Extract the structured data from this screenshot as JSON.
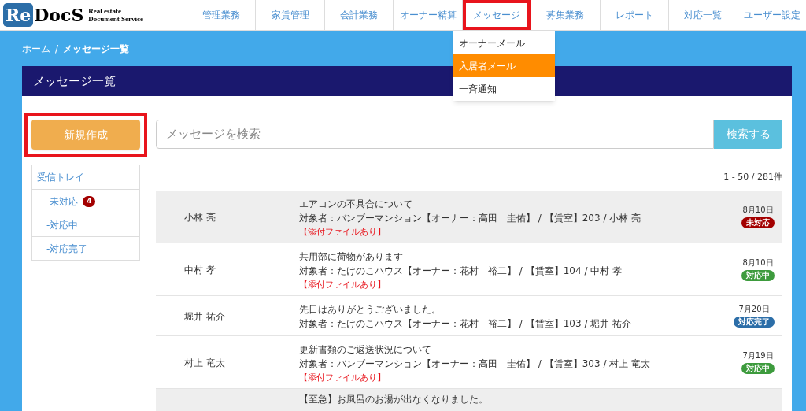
{
  "logo": {
    "mark": "Re",
    "name": "DocS",
    "tagline": [
      "Real estate",
      "Document Service"
    ]
  },
  "nav": [
    {
      "label": "管理業務",
      "annotated": false
    },
    {
      "label": "家賃管理",
      "annotated": false
    },
    {
      "label": "会計業務",
      "annotated": false
    },
    {
      "label": "オーナー精算",
      "annotated": false
    },
    {
      "label": "メッセージ",
      "annotated": true
    },
    {
      "label": "募集業務",
      "annotated": false
    },
    {
      "label": "レポート",
      "annotated": false
    },
    {
      "label": "対応一覧",
      "annotated": false
    },
    {
      "label": "ユーザー設定",
      "annotated": false
    }
  ],
  "dropdown": [
    {
      "label": "オーナーメール",
      "selected": false
    },
    {
      "label": "入居者メール",
      "selected": true
    },
    {
      "label": "一斉通知",
      "selected": false
    }
  ],
  "breadcrumb": [
    "ホーム",
    "/",
    "メッセージ一覧"
  ],
  "panel_title": "メッセージ一覧",
  "new_button": {
    "label": "新規作成",
    "annotated": true
  },
  "search": {
    "placeholder": "メッセージを検索",
    "button": "検索する"
  },
  "folders": [
    {
      "label": "受信トレイ",
      "child": false
    },
    {
      "label": "-未対応",
      "child": true,
      "badge": "4"
    },
    {
      "label": "-対応中",
      "child": true
    },
    {
      "label": "-対応完了",
      "child": true
    }
  ],
  "count": "1 - 50 / 281件",
  "messages": [
    {
      "sender": "小林 亮",
      "subject": "エアコンの不具合について",
      "target": "対象者：バンブーマンション【オーナー：高田　圭佑】 / 【賃室】203 / 小林 亮",
      "attachment": "【添付ファイルあり】",
      "date": "8月10日",
      "status": "未対応",
      "kind": "unhandled",
      "highlighted": true
    },
    {
      "sender": "中村 孝",
      "subject": "共用部に荷物があります",
      "target": "対象者：たけのこハウス【オーナー：花村　裕二】 / 【賃室】104 / 中村 孝",
      "attachment": "【添付ファイルあり】",
      "date": "8月10日",
      "status": "対応中",
      "kind": "in_progress",
      "highlighted": false
    },
    {
      "sender": "堀井 祐介",
      "subject": "先日はありがとうございました。",
      "target": "対象者：たけのこハウス【オーナー：花村　裕二】 / 【賃室】103 / 堀井 祐介",
      "date": "7月20日",
      "status": "対応完了",
      "kind": "done",
      "highlighted": false
    },
    {
      "sender": "村上 竜太",
      "subject": "更新書類のご返送状況について",
      "target": "対象者：バンブーマンション【オーナー：高田　圭佑】 / 【賃室】303 / 村上 竜太",
      "attachment": "【添付ファイルあり】",
      "date": "7月19日",
      "status": "対応中",
      "kind": "in_progress",
      "highlighted": false
    },
    {
      "subject": "【至急】お風呂のお湯が出なくなりました。",
      "highlighted": true
    }
  ]
}
